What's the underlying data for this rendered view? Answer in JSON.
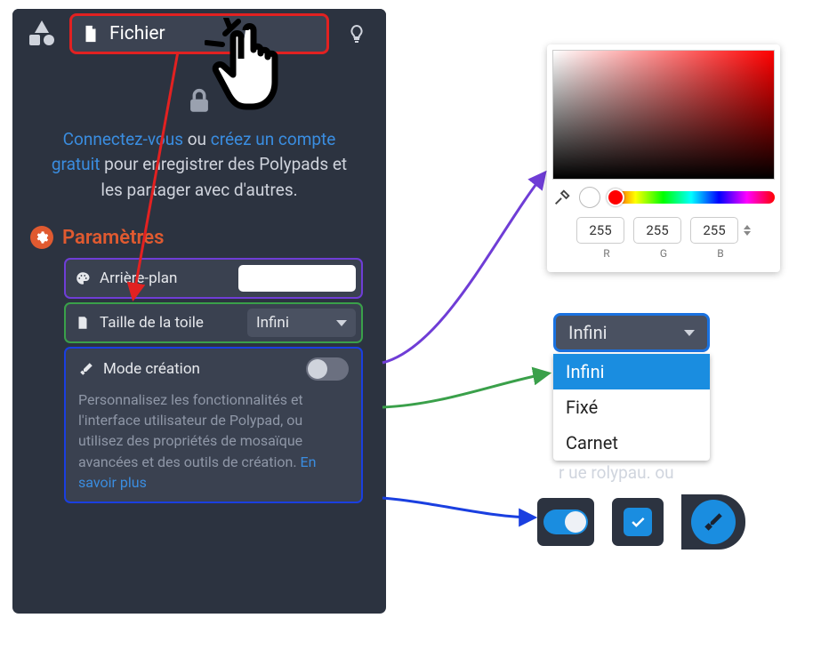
{
  "toolbar": {
    "file_label": "Fichier"
  },
  "signin": {
    "link_signin": "Connectez-vous",
    "txt_or": " ou ",
    "link_create": "créez un compte gratuit",
    "txt_rest": " pour enregistrer des Polypads et les partager avec d'autres."
  },
  "settings": {
    "heading": "Paramètres",
    "background": {
      "label": "Arrière-plan"
    },
    "canvas_size": {
      "label": "Taille de la toile",
      "value": "Infini"
    },
    "creation_mode": {
      "label": "Mode création",
      "description": "Personnalisez les fonctionnalités et l'interface utilisateur de Polypad, ou utilisez des propriétés de mosaïque avancées et des outils de création. ",
      "learn_more": "En savoir plus"
    }
  },
  "color_picker": {
    "r": "255",
    "g": "255",
    "b": "255",
    "r_label": "R",
    "g_label": "G",
    "b_label": "B"
  },
  "dropdown": {
    "selected": "Infini",
    "options": [
      "Infini",
      "Fixé",
      "Carnet"
    ],
    "trailing_text": "r ue rolypau. ou"
  }
}
